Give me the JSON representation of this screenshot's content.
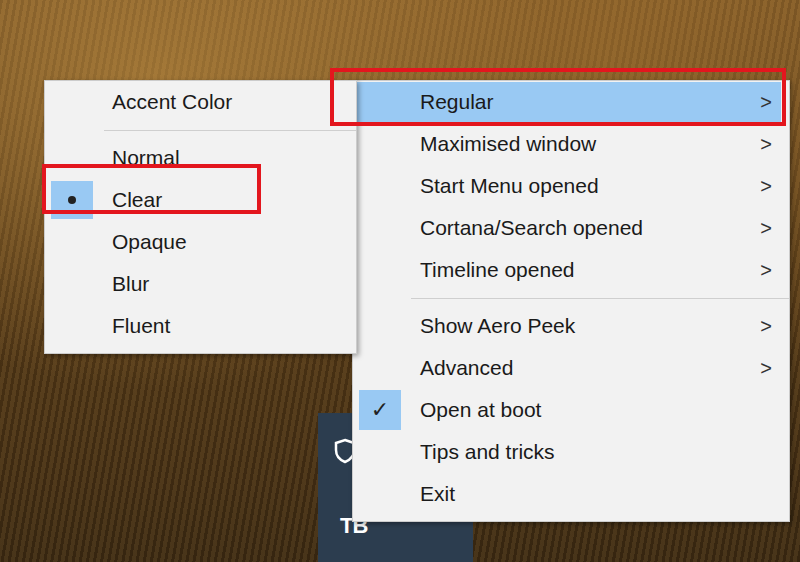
{
  "menu": {
    "groups": [
      {
        "items": [
          {
            "label": "Regular",
            "kind": "submenu",
            "arrow": ">",
            "highlighted": true,
            "checked": false
          },
          {
            "label": "Maximised window",
            "kind": "submenu",
            "arrow": ">",
            "highlighted": false,
            "checked": false
          },
          {
            "label": "Start Menu opened",
            "kind": "submenu",
            "arrow": ">",
            "highlighted": false,
            "checked": false
          },
          {
            "label": "Cortana/Search opened",
            "kind": "submenu",
            "arrow": ">",
            "highlighted": false,
            "checked": false
          },
          {
            "label": "Timeline opened",
            "kind": "submenu",
            "arrow": ">",
            "highlighted": false,
            "checked": false
          }
        ]
      },
      {
        "items": [
          {
            "label": "Show Aero Peek",
            "kind": "submenu",
            "arrow": ">",
            "highlighted": false,
            "checked": false
          },
          {
            "label": "Advanced",
            "kind": "submenu",
            "arrow": ">",
            "highlighted": false,
            "checked": false
          },
          {
            "label": "Open at boot",
            "kind": "toggle",
            "check": "✓",
            "highlighted": false,
            "checked": true
          },
          {
            "label": "Tips and tricks",
            "kind": "action",
            "highlighted": false,
            "checked": false
          },
          {
            "label": "Exit",
            "kind": "action",
            "highlighted": false,
            "checked": false
          }
        ]
      }
    ]
  },
  "submenu": {
    "header": "Accent Color",
    "items": [
      {
        "label": "Normal",
        "selected": false
      },
      {
        "label": "Clear",
        "selected": true
      },
      {
        "label": "Opaque",
        "selected": false
      },
      {
        "label": "Blur",
        "selected": false
      },
      {
        "label": "Fluent",
        "selected": false
      }
    ]
  },
  "tray": {
    "logo": "TB"
  }
}
